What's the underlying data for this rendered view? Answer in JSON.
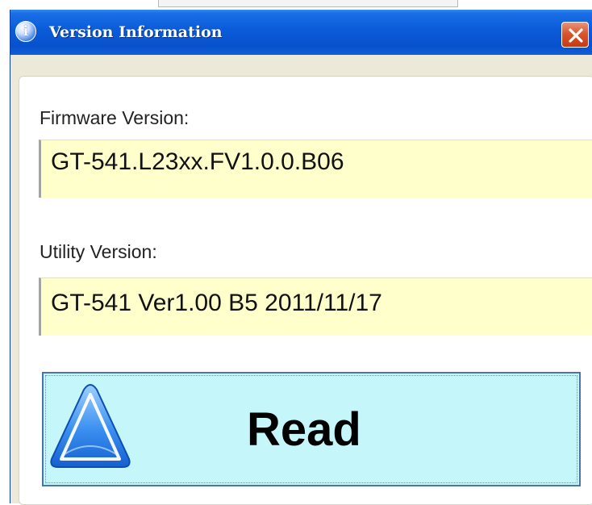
{
  "window": {
    "title": "Version Information",
    "title_icon": "info-icon",
    "close_icon": "close-icon"
  },
  "firmware": {
    "label": "Firmware Version:",
    "value": "GT-541.L23xx.FV1.0.0.B06"
  },
  "utility": {
    "label": "Utility Version:",
    "value": "GT-541 Ver1.00 B5 2011/11/17"
  },
  "read_button": {
    "label": "Read",
    "icon": "triangle-icon"
  },
  "colors": {
    "titlebar": "#0b5bd9",
    "close_button": "#d9562f",
    "field_background": "#ffffcc",
    "read_button_background": "#c4f6fa"
  }
}
